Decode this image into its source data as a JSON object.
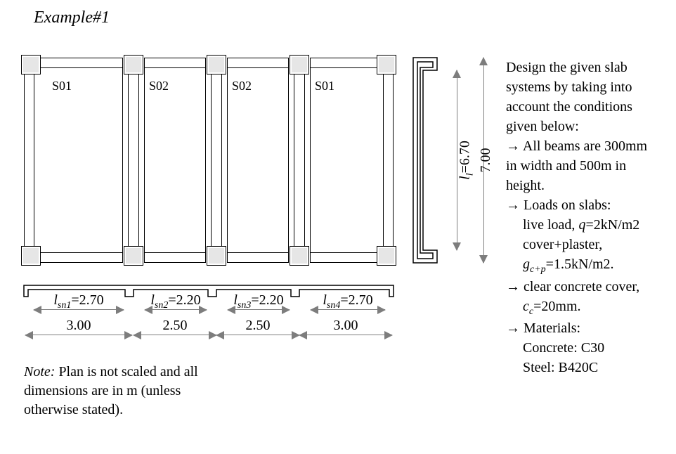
{
  "title": "Example#1",
  "slab_labels": {
    "s1": "S01",
    "s2": "S02",
    "s3": "S02",
    "s4": "S01"
  },
  "vdim": {
    "inner_sym": "l",
    "inner_sub": "l",
    "inner_val": "=6.70",
    "outer_val": "7.00"
  },
  "lsn": {
    "sym": "l",
    "sub1": "sn1",
    "val1": "=2.70",
    "sub2": "sn2",
    "val2": "=2.20",
    "sub3": "sn3",
    "val3": "=2.20",
    "sub4": "sn4",
    "val4": "=2.70"
  },
  "spans": {
    "s1": "3.00",
    "s2": "2.50",
    "s3": "2.50",
    "s4": "3.00"
  },
  "note": {
    "head": "Note:",
    "l1": " Plan is not scaled and all",
    "l2": "dimensions are in m (unless",
    "l3": "otherwise stated)."
  },
  "rhs": {
    "l1": "Design the given slab",
    "l2": "systems by taking into",
    "l3": "account the conditions",
    "l4": "given below:",
    "l5a": "→ All beams are 300mm",
    "l5b": "in width and 500m in",
    "l5c": "height.",
    "l6": "→ Loads on slabs:",
    "l6a_pre": "live load, ",
    "l6a_sym": "q",
    "l6a_post": "=2kN/m2",
    "l6b": "cover+plaster,",
    "l6c_sym": "g",
    "l6c_sub": "c+p",
    "l6c_post": "=1.5kN/m2.",
    "l7": "→ clear concrete cover,",
    "l7a_sym": "c",
    "l7a_sub": "c",
    "l7a_post": "=20mm.",
    "l8": "→ Materials:",
    "l8a": "Concrete: C30",
    "l8b": "Steel: B420C"
  },
  "chart_data": {
    "type": "diagram",
    "description": "Plan of a one-way slab strip with 4 bays between 5 column lines, plus side elevation dimension and span dimensions.",
    "bays": [
      {
        "name": "S01",
        "span_m": 3.0,
        "clear_span_m": 2.7
      },
      {
        "name": "S02",
        "span_m": 2.5,
        "clear_span_m": 2.2
      },
      {
        "name": "S02",
        "span_m": 2.5,
        "clear_span_m": 2.2
      },
      {
        "name": "S01",
        "span_m": 3.0,
        "clear_span_m": 2.7
      }
    ],
    "transverse": {
      "clear_m": 6.7,
      "overall_m": 7.0
    },
    "beams": {
      "width_mm": 300,
      "height_mm": 500
    },
    "loads": {
      "live_kN_per_m2": 2.0,
      "cover_plaster_kN_per_m2": 1.5
    },
    "clear_cover_mm": 20,
    "materials": {
      "concrete": "C30",
      "steel": "B420C"
    }
  }
}
